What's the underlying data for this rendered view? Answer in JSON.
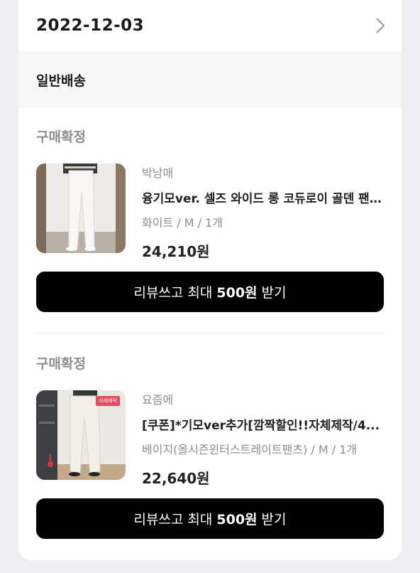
{
  "header": {
    "date": "2022-12-03"
  },
  "shipping": {
    "label": "일반배송"
  },
  "orders": [
    {
      "status": "구매확정",
      "brand": "박남매",
      "product_name": "융기모ver. 셀즈 와이드 롱 코듀로이 골덴 팬...",
      "option": "화이트 / M /  1개",
      "price": "24,210원",
      "review_prefix": "리뷰쓰고 최대",
      "review_amount": "500원",
      "review_suffix": "받기"
    },
    {
      "status": "구매확정",
      "brand": "요즘에",
      "product_name": "[쿠폰]*기모ver추가[깜짝할인!!자체제작/4...",
      "option": "베이지(올시즌윈터스트레이트팬츠) / M /  1개",
      "price": "22,640원",
      "badge": "자체제작",
      "review_prefix": "리뷰쓰고 최대",
      "review_amount": "500원",
      "review_suffix": "받기"
    }
  ],
  "icons": {
    "chevron": "chevron-right-icon"
  }
}
